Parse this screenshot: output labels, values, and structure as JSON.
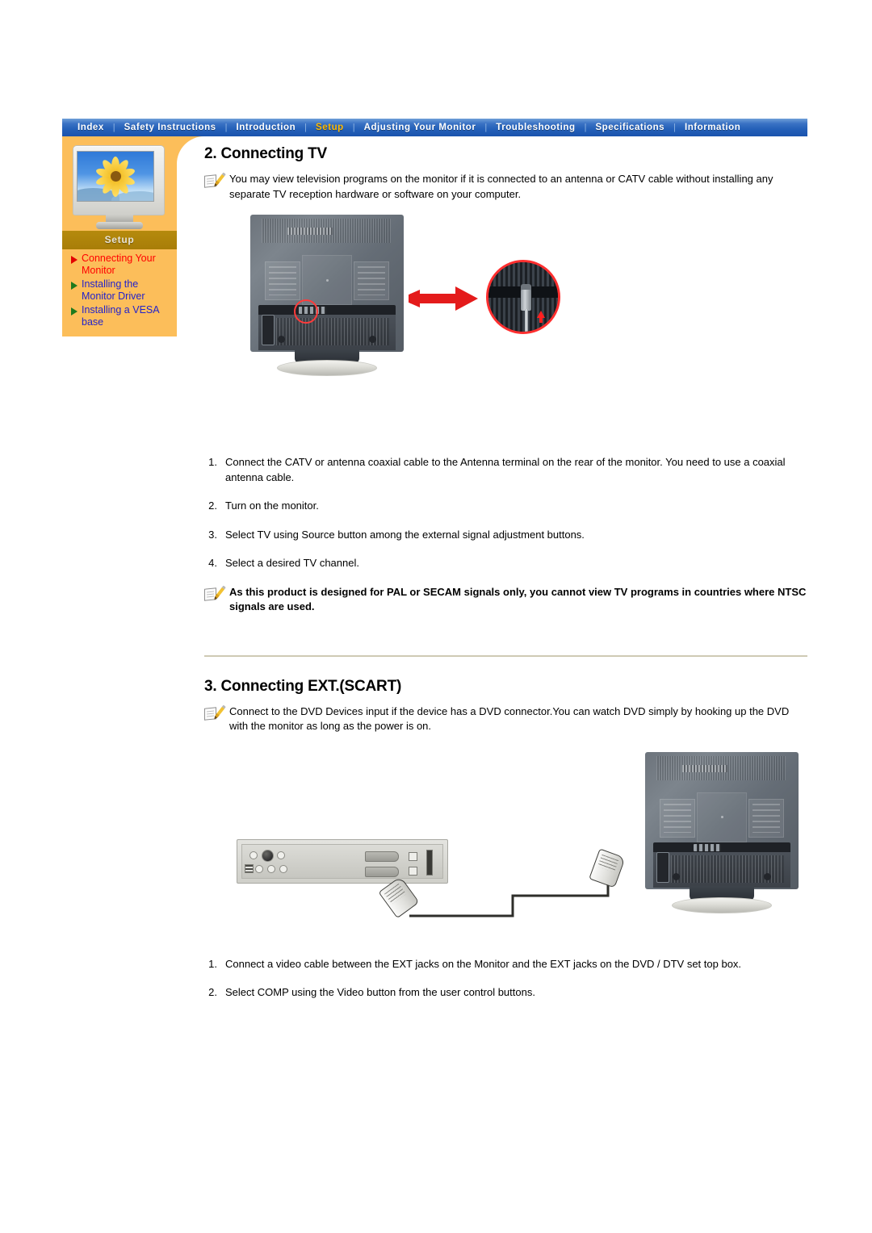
{
  "nav": {
    "items": [
      {
        "label": "Index",
        "active": false
      },
      {
        "label": "Safety Instructions",
        "active": false
      },
      {
        "label": "Introduction",
        "active": false
      },
      {
        "label": "Setup",
        "active": true
      },
      {
        "label": "Adjusting Your Monitor",
        "active": false
      },
      {
        "label": "Troubleshooting",
        "active": false
      },
      {
        "label": "Specifications",
        "active": false
      },
      {
        "label": "Information",
        "active": false
      }
    ],
    "separator": "|"
  },
  "sidebar": {
    "band_label": "Setup",
    "thumbnail_icon": "monitor-sunflower-icon",
    "links": [
      {
        "label": "Connecting Your Monitor",
        "active": true
      },
      {
        "label": "Installing the Monitor Driver",
        "active": false
      },
      {
        "label": "Installing a VESA base",
        "active": false
      }
    ]
  },
  "sections": [
    {
      "title": "2. Connecting TV",
      "note": "You may view television programs on the monitor if it is connected to an antenna or CATV cable without installing any separate TV reception hardware or software on your computer.",
      "figure_icon": "monitor-rear-antenna-diagram",
      "steps": [
        {
          "num": "1.",
          "text": "Connect the CATV or antenna coaxial cable to the Antenna terminal on the rear of the monitor. You need to use a coaxial antenna cable."
        },
        {
          "num": "2.",
          "text": "Turn on the monitor."
        },
        {
          "num": "3.",
          "text": "Select TV using Source button among the external signal adjustment buttons."
        },
        {
          "num": "4.",
          "text": "Select a desired TV channel."
        }
      ],
      "warning": "As this product is designed for PAL or SECAM signals only, you cannot view TV programs in countries where NTSC signals are used."
    },
    {
      "title": "3. Connecting EXT.(SCART)",
      "note": "Connect to the DVD Devices input if the device has a DVD connector.You can watch DVD simply by hooking up the DVD with the monitor as long as the power is on.",
      "figure_icon": "dvd-scart-connection-diagram",
      "steps": [
        {
          "num": "1.",
          "text": "Connect a video cable between the EXT jacks on the Monitor and the EXT jacks on the DVD / DTV set top box."
        },
        {
          "num": "2.",
          "text": "Select COMP using the Video button from the user control buttons."
        }
      ]
    }
  ],
  "colors": {
    "nav_background": "#2360b8",
    "nav_active_text": "#ffb900",
    "sidebar_panel": "#fcbe5a",
    "sidebar_band": "#a87d08",
    "link_active": "#ff0000",
    "link_inactive": "#2222cc",
    "bullet_active": "#e30000",
    "bullet_inactive": "#1d7a1d",
    "highlight_red": "#ff3b3b",
    "divider": "#cfcab4"
  }
}
